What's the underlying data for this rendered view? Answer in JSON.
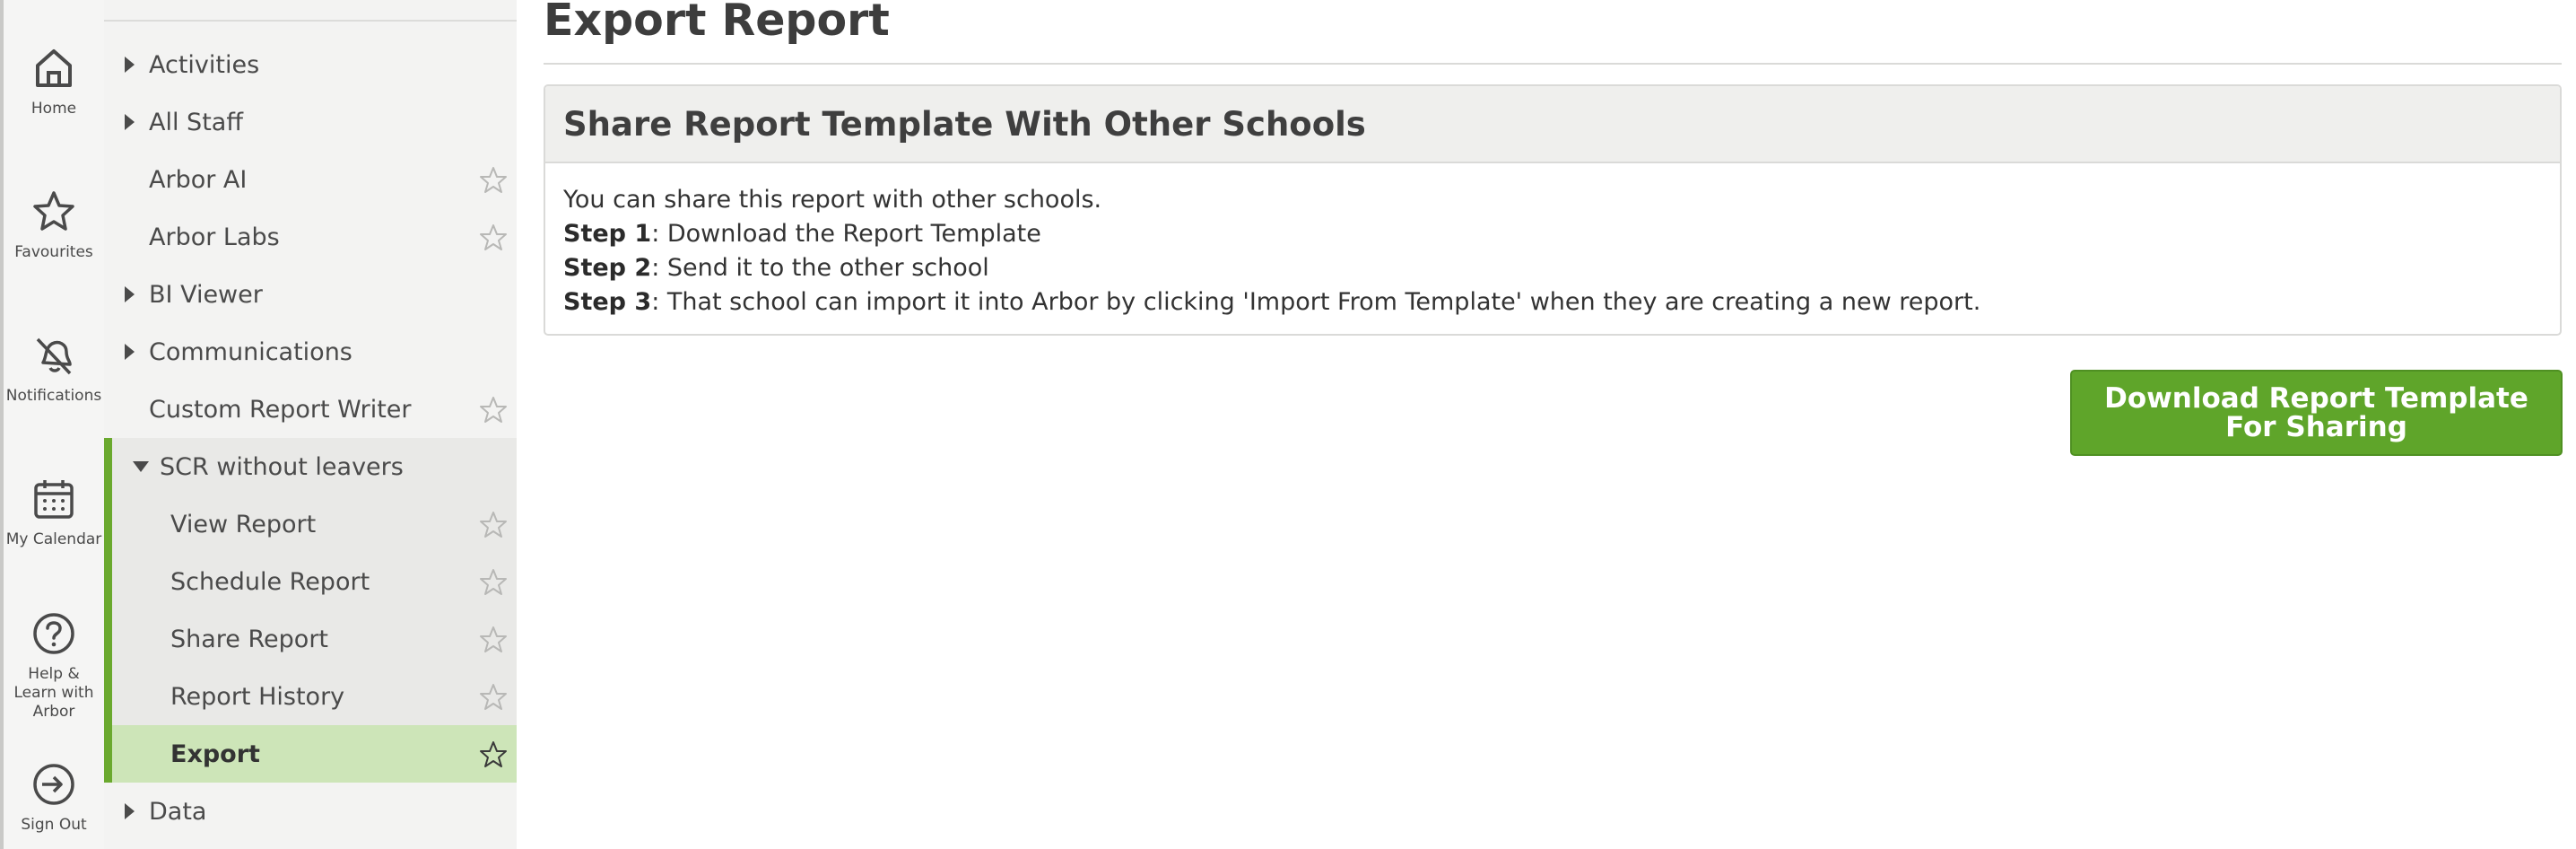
{
  "rail": {
    "items": [
      {
        "label": "Home",
        "icon": "home-icon"
      },
      {
        "label": "Favourites",
        "icon": "star-icon"
      },
      {
        "label": "Notifications",
        "icon": "bell-off-icon"
      },
      {
        "label": "My Calendar",
        "icon": "calendar-icon"
      },
      {
        "label": "Help & Learn with Arbor",
        "icon": "help-circle-icon"
      },
      {
        "label": "Sign Out",
        "icon": "sign-out-icon"
      }
    ]
  },
  "tree": {
    "items": [
      {
        "label": "Activities"
      },
      {
        "label": "All Staff"
      },
      {
        "label": "Arbor AI"
      },
      {
        "label": "Arbor Labs"
      },
      {
        "label": "BI Viewer"
      },
      {
        "label": "Communications"
      },
      {
        "label": "Custom Report Writer"
      },
      {
        "label": "SCR without leavers"
      },
      {
        "label": "View Report"
      },
      {
        "label": "Schedule Report"
      },
      {
        "label": "Share Report"
      },
      {
        "label": "Report History"
      },
      {
        "label": "Export"
      },
      {
        "label": "Data"
      }
    ]
  },
  "main": {
    "title": "Export Report",
    "panel": {
      "heading": "Share Report Template With Other Schools",
      "intro": "You can share this report with other schools.",
      "steps": [
        {
          "label": "Step 1",
          "text": ": Download the Report Template"
        },
        {
          "label": "Step 2",
          "text": ": Send it to the other school"
        },
        {
          "label": "Step 3",
          "text": ": That school can import it into Arbor by clicking 'Import From Template' when they are creating a new report."
        }
      ]
    },
    "download_button": "Download Report Template For Sharing"
  },
  "colors": {
    "accent_green": "#5fa52a",
    "active_row": "#cde5b8",
    "group_bar": "#6aa92e"
  }
}
